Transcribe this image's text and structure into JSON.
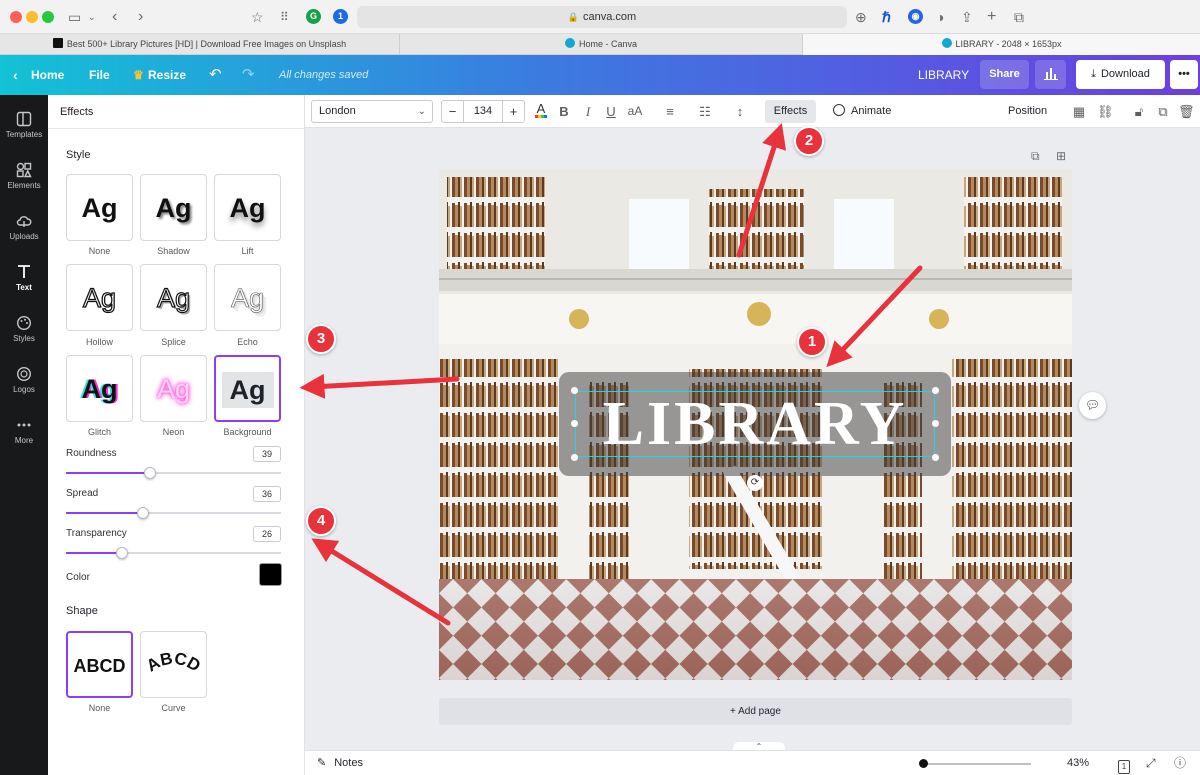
{
  "browser": {
    "url": "canva.com",
    "tabs": [
      {
        "title": "Best 500+ Library Pictures [HD] | Download Free Images on Unsplash"
      },
      {
        "title": "Home - Canva"
      },
      {
        "title": "LIBRARY - 2048 × 1653px"
      }
    ]
  },
  "header": {
    "home_label": "Home",
    "file_label": "File",
    "resize_label": "Resize",
    "saved_status": "All changes saved",
    "design_title": "LIBRARY",
    "share_label": "Share",
    "download_label": "Download"
  },
  "rail": {
    "items": [
      {
        "label": "Templates"
      },
      {
        "label": "Elements"
      },
      {
        "label": "Uploads"
      },
      {
        "label": "Text"
      },
      {
        "label": "Styles"
      },
      {
        "label": "Logos"
      },
      {
        "label": "More"
      }
    ]
  },
  "panel": {
    "title": "Effects",
    "style_label": "Style",
    "effects": [
      {
        "name": "None",
        "sample": "Ag"
      },
      {
        "name": "Shadow",
        "sample": "Ag"
      },
      {
        "name": "Lift",
        "sample": "Ag"
      },
      {
        "name": "Hollow",
        "sample": "Ag"
      },
      {
        "name": "Splice",
        "sample": "Ag"
      },
      {
        "name": "Echo",
        "sample": "Ag"
      },
      {
        "name": "Glitch",
        "sample": "Ag"
      },
      {
        "name": "Neon",
        "sample": "Ag"
      },
      {
        "name": "Background",
        "sample": "Ag"
      }
    ],
    "selected_effect": "Background",
    "controls": {
      "roundness": {
        "label": "Roundness",
        "value": "39",
        "level": 39
      },
      "spread": {
        "label": "Spread",
        "value": "36",
        "level": 36
      },
      "transparency": {
        "label": "Transparency",
        "value": "26",
        "level": 26
      }
    },
    "color_label": "Color",
    "color_value": "#000000",
    "shape_label": "Shape",
    "shapes": [
      {
        "name": "None",
        "sample": "ABCD"
      },
      {
        "name": "Curve",
        "sample": "ABCD"
      }
    ]
  },
  "toolbar": {
    "font": "London",
    "font_size": "134",
    "effects_label": "Effects",
    "animate_label": "Animate",
    "position_label": "Position"
  },
  "canvas": {
    "text": "LIBRARY",
    "add_page_label": "+ Add page"
  },
  "bottom": {
    "notes_label": "Notes",
    "zoom": "43%",
    "page_count": "1"
  },
  "annotations": [
    {
      "number": "1"
    },
    {
      "number": "2"
    },
    {
      "number": "3"
    },
    {
      "number": "4"
    }
  ],
  "colors": {
    "accent": "#8b3dff",
    "annotation": "#e8323c"
  }
}
